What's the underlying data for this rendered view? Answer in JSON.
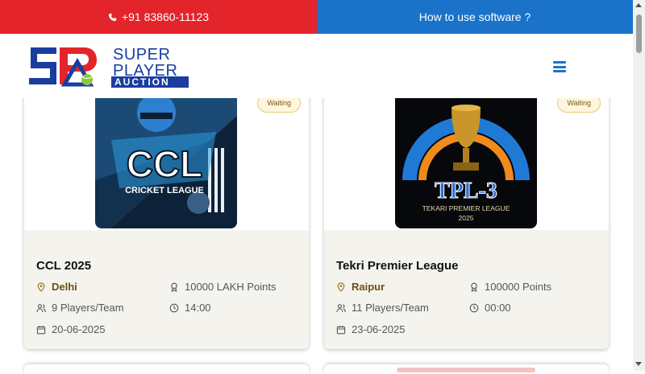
{
  "topbar": {
    "phone": "+91 83860-11123",
    "help_link": "How to use software ?"
  },
  "logo": {
    "line1": "SUPER",
    "line2": "PLAYER",
    "line3": "AUCTION"
  },
  "colors": {
    "red": "#e3242b",
    "blue": "#1a73c9",
    "card_bg": "#f4f3ee"
  },
  "cards": [
    {
      "status": "Waiting",
      "image_text": "CCL",
      "image_sub": "CRICKET LEAGUE",
      "title": "CCL 2025",
      "location": "Delhi",
      "points": "10000 LAKH Points",
      "players": "9 Players/Team",
      "time": "14:00",
      "date": "20-06-2025"
    },
    {
      "status": "Waiting",
      "image_text": "TPL-3",
      "image_sub": "TEKARI PREMIER LEAGUE",
      "image_year": "2025",
      "title": "Tekri Premier League",
      "location": "Raipur",
      "points": "100000 Points",
      "players": "11 Players/Team",
      "time": "00:00",
      "date": "23-06-2025"
    }
  ]
}
